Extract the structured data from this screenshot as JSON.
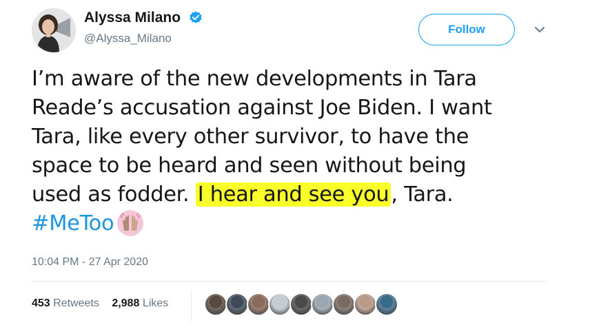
{
  "author": {
    "display_name": "Alyssa Milano",
    "handle": "@Alyssa_Milano",
    "verified": true,
    "avatar_icon": "profile-photo-icon"
  },
  "actions": {
    "follow_label": "Follow",
    "menu_icon": "chevron-down-icon"
  },
  "tweet": {
    "lines": [
      "I’m aware of the new developments in Tara",
      "Reade’s accusation against Joe Biden. I want",
      "Tara, like every other survivor, to have the",
      "space to be heard and seen without being"
    ],
    "line5_before": "used as fodder. ",
    "line5_highlight": "I hear and see you",
    "line5_after": ", Tara.",
    "hashtag": "#MeToo",
    "emoji_icon": "raised-hands-emoji-icon",
    "highlight_color": "#fbff29"
  },
  "meta": {
    "timestamp": "10:04 PM - 27 Apr 2020"
  },
  "stats": {
    "retweets_count": "453",
    "retweets_label": "Retweets",
    "likes_count": "2,988",
    "likes_label": "Likes"
  },
  "likers": [
    {
      "color": "#5a4a3e"
    },
    {
      "color": "#3e4a5a"
    },
    {
      "color": "#8a6a5a"
    },
    {
      "color": "#c4ccd4"
    },
    {
      "color": "#4a4a4a"
    },
    {
      "color": "#9aa6b2"
    },
    {
      "color": "#7a6a62"
    },
    {
      "color": "#b89a86"
    },
    {
      "color": "#3a6a8a"
    }
  ],
  "colors": {
    "accent": "#1da1f2",
    "hashtag": "#1b95e0",
    "text": "#14171a",
    "muted": "#657786"
  }
}
